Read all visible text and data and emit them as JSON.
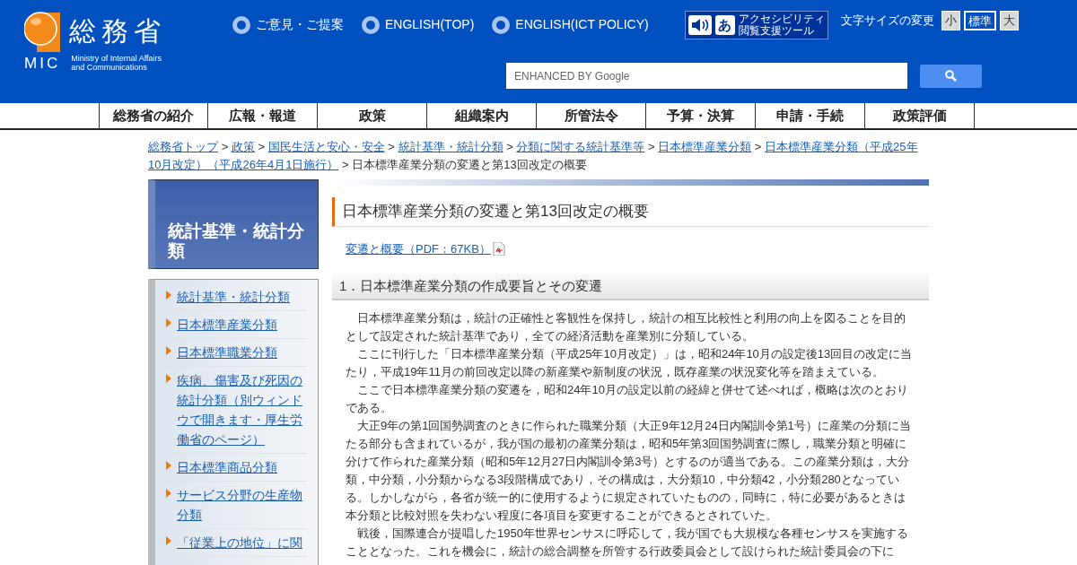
{
  "header": {
    "logo": {
      "name_ja": "総務省",
      "abbr": "MIC",
      "name_en": [
        "Ministry of Internal Affairs",
        "and Communications"
      ]
    },
    "top_links": [
      "ご意見・ご提案",
      "ENGLISH(TOP)",
      "ENGLISH(ICT POLICY)"
    ],
    "accessibility_tool": {
      "glyph": "あ",
      "lines": [
        "アクセシビリティ",
        "閲覧支援ツール"
      ]
    },
    "font_size": {
      "label": "文字サイズの変更",
      "options": [
        {
          "label": "小",
          "selected": false
        },
        {
          "label": "標準",
          "selected": true
        },
        {
          "label": "大",
          "selected": false
        }
      ]
    },
    "search": {
      "placeholder": "ENHANCED BY Google"
    }
  },
  "nav": [
    "総務省の紹介",
    "広報・報道",
    "政策",
    "組織案内",
    "所管法令",
    "予算・決算",
    "申請・手続",
    "政策評価"
  ],
  "breadcrumb_separator": ">",
  "breadcrumb": [
    {
      "label": "総務省トップ",
      "link": true
    },
    {
      "label": "政策",
      "link": true
    },
    {
      "label": "国民生活と安心・安全",
      "link": true
    },
    {
      "label": "統計基準・統計分類",
      "link": true
    },
    {
      "label": "分類に関する統計基準等",
      "link": true
    },
    {
      "label": "日本標準産業分類",
      "link": true
    },
    {
      "lines": [
        "日本標準産業分類（平成25年",
        "10月改定）（平成26年4月1日施行）"
      ],
      "link": true
    },
    {
      "label": "日本標準産業分類の変遷と第13回改定の概要",
      "link": false
    }
  ],
  "sidebar": {
    "title": "統計基準・統計分類",
    "items": [
      "統計基準・統計分類",
      "日本標準産業分類",
      "日本標準職業分類",
      "疾病、傷害及び死因の統計分類（別ウィンドウで開きます・厚生労働省のページ）",
      "日本標準商品分類",
      "サービス分野の生産物分類",
      "「従業上の地位」に関"
    ]
  },
  "content": {
    "title": "日本標準産業分類の変遷と第13回改定の概要",
    "pdf_link": "変遷と概要（PDF：67KB）",
    "section_heading": "1．日本標準産業分類の作成要旨とその変遷",
    "paragraphs": [
      "日本標準産業分類は，統計の正確性と客観性を保持し，統計の相互比較性と利用の向上を図ることを目的として設定された統計基準であり，全ての経済活動を産業別に分類している。",
      "ここに刊行した「日本標準産業分類（平成25年10月改定）」は，昭和24年10月の設定後13回目の改定に当たり，平成19年11月の前回改定以降の新産業や新制度の状況，既存産業の状況変化等を踏まえている。",
      "ここで日本標準産業分類の変遷を，昭和24年10月の設定以前の経緯と併せて述べれば，概略は次のとおりである。",
      "大正9年の第1回国勢調査のときに作られた職業分類（大正9年12月24日内閣訓令第1号）に産業の分類に当たる部分も含まれているが，我が国の最初の産業分類は，昭和5年第3回国勢調査に際し，職業分類と明確に分けて作られた産業分類（昭和5年12月27日内閣訓令第3号）とするのが適当である。この産業分類は，大分類，中分類，小分類からなる3段階構成であり，その構成は，大分類10，中分類42，小分類280となっている。しかしながら，各省が統一的に使用するように規定されていたものの，同時に，特に必要があるときは本分類と比較対照を失わない程度に各項目を変更することができるとされていた。",
      "戦後，国際連合が提唱した1950年世界センサスに呼応して，我が国でも大規模な各種センサスを実施することとなった。これを機会に，統計の総合調整を所管する行政委員会として設けられた統計委員会の下に"
    ]
  }
}
